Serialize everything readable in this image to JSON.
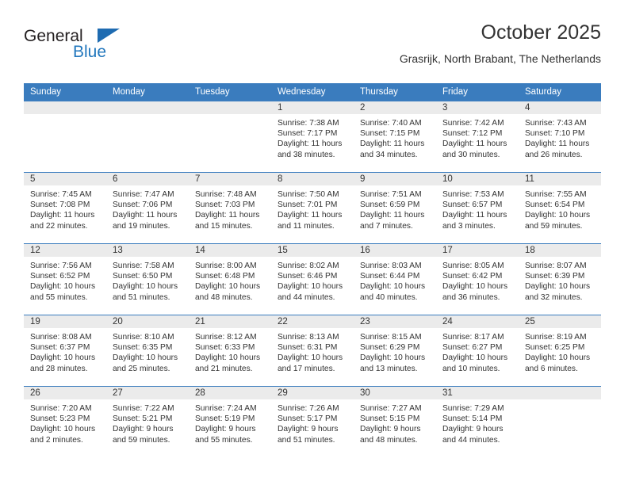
{
  "brand": {
    "name_top": "General",
    "name_bottom": "Blue",
    "color_dark": "#231f20",
    "color_blue": "#2277bd"
  },
  "header": {
    "title": "October 2025",
    "subtitle": "Grasrijk, North Brabant, The Netherlands",
    "header_bg": "#3a7cbe",
    "daynum_bg": "#ebebeb"
  },
  "weekday_headers": [
    "Sunday",
    "Monday",
    "Tuesday",
    "Wednesday",
    "Thursday",
    "Friday",
    "Saturday"
  ],
  "weeks": [
    [
      {
        "day": "",
        "lines": []
      },
      {
        "day": "",
        "lines": []
      },
      {
        "day": "",
        "lines": []
      },
      {
        "day": "1",
        "lines": [
          "Sunrise: 7:38 AM",
          "Sunset: 7:17 PM",
          "Daylight: 11 hours",
          "and 38 minutes."
        ]
      },
      {
        "day": "2",
        "lines": [
          "Sunrise: 7:40 AM",
          "Sunset: 7:15 PM",
          "Daylight: 11 hours",
          "and 34 minutes."
        ]
      },
      {
        "day": "3",
        "lines": [
          "Sunrise: 7:42 AM",
          "Sunset: 7:12 PM",
          "Daylight: 11 hours",
          "and 30 minutes."
        ]
      },
      {
        "day": "4",
        "lines": [
          "Sunrise: 7:43 AM",
          "Sunset: 7:10 PM",
          "Daylight: 11 hours",
          "and 26 minutes."
        ]
      }
    ],
    [
      {
        "day": "5",
        "lines": [
          "Sunrise: 7:45 AM",
          "Sunset: 7:08 PM",
          "Daylight: 11 hours",
          "and 22 minutes."
        ]
      },
      {
        "day": "6",
        "lines": [
          "Sunrise: 7:47 AM",
          "Sunset: 7:06 PM",
          "Daylight: 11 hours",
          "and 19 minutes."
        ]
      },
      {
        "day": "7",
        "lines": [
          "Sunrise: 7:48 AM",
          "Sunset: 7:03 PM",
          "Daylight: 11 hours",
          "and 15 minutes."
        ]
      },
      {
        "day": "8",
        "lines": [
          "Sunrise: 7:50 AM",
          "Sunset: 7:01 PM",
          "Daylight: 11 hours",
          "and 11 minutes."
        ]
      },
      {
        "day": "9",
        "lines": [
          "Sunrise: 7:51 AM",
          "Sunset: 6:59 PM",
          "Daylight: 11 hours",
          "and 7 minutes."
        ]
      },
      {
        "day": "10",
        "lines": [
          "Sunrise: 7:53 AM",
          "Sunset: 6:57 PM",
          "Daylight: 11 hours",
          "and 3 minutes."
        ]
      },
      {
        "day": "11",
        "lines": [
          "Sunrise: 7:55 AM",
          "Sunset: 6:54 PM",
          "Daylight: 10 hours",
          "and 59 minutes."
        ]
      }
    ],
    [
      {
        "day": "12",
        "lines": [
          "Sunrise: 7:56 AM",
          "Sunset: 6:52 PM",
          "Daylight: 10 hours",
          "and 55 minutes."
        ]
      },
      {
        "day": "13",
        "lines": [
          "Sunrise: 7:58 AM",
          "Sunset: 6:50 PM",
          "Daylight: 10 hours",
          "and 51 minutes."
        ]
      },
      {
        "day": "14",
        "lines": [
          "Sunrise: 8:00 AM",
          "Sunset: 6:48 PM",
          "Daylight: 10 hours",
          "and 48 minutes."
        ]
      },
      {
        "day": "15",
        "lines": [
          "Sunrise: 8:02 AM",
          "Sunset: 6:46 PM",
          "Daylight: 10 hours",
          "and 44 minutes."
        ]
      },
      {
        "day": "16",
        "lines": [
          "Sunrise: 8:03 AM",
          "Sunset: 6:44 PM",
          "Daylight: 10 hours",
          "and 40 minutes."
        ]
      },
      {
        "day": "17",
        "lines": [
          "Sunrise: 8:05 AM",
          "Sunset: 6:42 PM",
          "Daylight: 10 hours",
          "and 36 minutes."
        ]
      },
      {
        "day": "18",
        "lines": [
          "Sunrise: 8:07 AM",
          "Sunset: 6:39 PM",
          "Daylight: 10 hours",
          "and 32 minutes."
        ]
      }
    ],
    [
      {
        "day": "19",
        "lines": [
          "Sunrise: 8:08 AM",
          "Sunset: 6:37 PM",
          "Daylight: 10 hours",
          "and 28 minutes."
        ]
      },
      {
        "day": "20",
        "lines": [
          "Sunrise: 8:10 AM",
          "Sunset: 6:35 PM",
          "Daylight: 10 hours",
          "and 25 minutes."
        ]
      },
      {
        "day": "21",
        "lines": [
          "Sunrise: 8:12 AM",
          "Sunset: 6:33 PM",
          "Daylight: 10 hours",
          "and 21 minutes."
        ]
      },
      {
        "day": "22",
        "lines": [
          "Sunrise: 8:13 AM",
          "Sunset: 6:31 PM",
          "Daylight: 10 hours",
          "and 17 minutes."
        ]
      },
      {
        "day": "23",
        "lines": [
          "Sunrise: 8:15 AM",
          "Sunset: 6:29 PM",
          "Daylight: 10 hours",
          "and 13 minutes."
        ]
      },
      {
        "day": "24",
        "lines": [
          "Sunrise: 8:17 AM",
          "Sunset: 6:27 PM",
          "Daylight: 10 hours",
          "and 10 minutes."
        ]
      },
      {
        "day": "25",
        "lines": [
          "Sunrise: 8:19 AM",
          "Sunset: 6:25 PM",
          "Daylight: 10 hours",
          "and 6 minutes."
        ]
      }
    ],
    [
      {
        "day": "26",
        "lines": [
          "Sunrise: 7:20 AM",
          "Sunset: 5:23 PM",
          "Daylight: 10 hours",
          "and 2 minutes."
        ]
      },
      {
        "day": "27",
        "lines": [
          "Sunrise: 7:22 AM",
          "Sunset: 5:21 PM",
          "Daylight: 9 hours",
          "and 59 minutes."
        ]
      },
      {
        "day": "28",
        "lines": [
          "Sunrise: 7:24 AM",
          "Sunset: 5:19 PM",
          "Daylight: 9 hours",
          "and 55 minutes."
        ]
      },
      {
        "day": "29",
        "lines": [
          "Sunrise: 7:26 AM",
          "Sunset: 5:17 PM",
          "Daylight: 9 hours",
          "and 51 minutes."
        ]
      },
      {
        "day": "30",
        "lines": [
          "Sunrise: 7:27 AM",
          "Sunset: 5:15 PM",
          "Daylight: 9 hours",
          "and 48 minutes."
        ]
      },
      {
        "day": "31",
        "lines": [
          "Sunrise: 7:29 AM",
          "Sunset: 5:14 PM",
          "Daylight: 9 hours",
          "and 44 minutes."
        ]
      },
      {
        "day": "",
        "lines": []
      }
    ]
  ]
}
